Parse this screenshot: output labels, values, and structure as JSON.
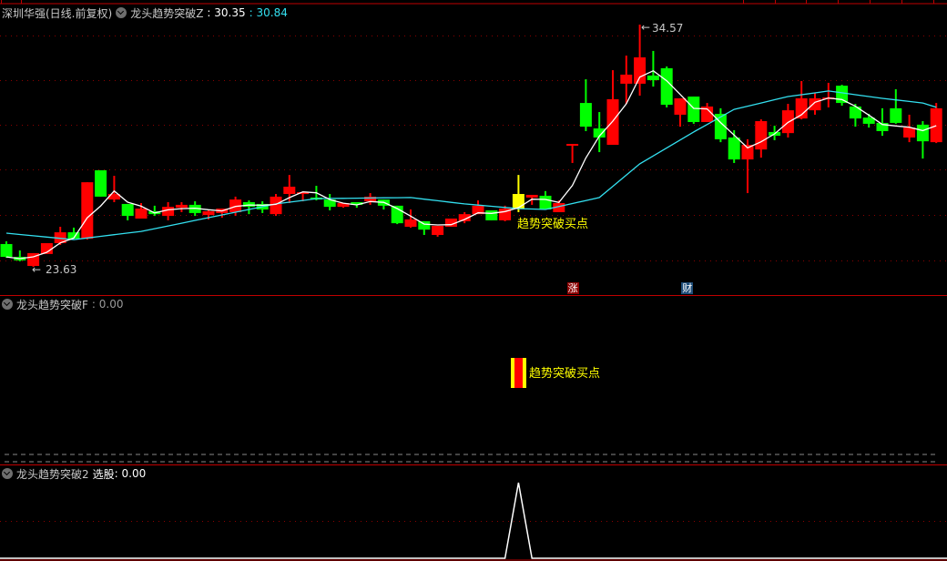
{
  "header": {
    "stock": "深圳华强(日线.前复权)",
    "indicator": "龙头趋势突破Z",
    "value_white": ": 30.35",
    "value_cyan": ": 30.84"
  },
  "panel2": {
    "title": "龙头趋势突破F",
    "value": ": 0.00",
    "signal_label": "趋势突破买点"
  },
  "panel3": {
    "title": "龙头趋势突破2",
    "label": "选股",
    "value": ": 0.00"
  },
  "main": {
    "signal_label": "趋势突破买点",
    "high_label": "34.57",
    "low_label": "23.63",
    "tag_zhang": "涨",
    "tag_cai": "财"
  },
  "colors": {
    "up": "#ff0000",
    "down": "#00ff00",
    "signal": "#ffff00",
    "ma_short": "#ffffff",
    "ma_long": "#33e0f0",
    "grid": "#8b0000"
  },
  "chart_data": {
    "type": "candlestick",
    "title": "深圳华强(日线.前复权)",
    "price_range": [
      23.63,
      34.57
    ],
    "ohlc": [
      [
        24.66,
        24.78,
        24.04,
        24.08
      ],
      [
        24.08,
        24.37,
        23.88,
        23.92
      ],
      [
        23.67,
        24.25,
        23.63,
        24.25
      ],
      [
        24.21,
        24.7,
        24.21,
        24.7
      ],
      [
        24.7,
        25.44,
        24.62,
        25.19
      ],
      [
        25.19,
        25.4,
        24.9,
        24.9
      ],
      [
        24.9,
        27.45,
        24.86,
        27.45
      ],
      [
        27.99,
        27.99,
        26.8,
        26.8
      ],
      [
        26.67,
        27.74,
        26.55,
        26.92
      ],
      [
        26.47,
        26.47,
        25.73,
        25.93
      ],
      [
        25.81,
        26.51,
        25.81,
        26.26
      ],
      [
        26.14,
        26.39,
        25.93,
        26.01
      ],
      [
        25.93,
        26.55,
        25.73,
        26.34
      ],
      [
        26.3,
        26.55,
        26.1,
        26.43
      ],
      [
        26.43,
        26.59,
        25.93,
        26.06
      ],
      [
        25.97,
        26.18,
        25.77,
        26.14
      ],
      [
        26.06,
        26.26,
        25.85,
        26.26
      ],
      [
        26.1,
        26.8,
        25.93,
        26.67
      ],
      [
        26.55,
        26.63,
        26.01,
        26.34
      ],
      [
        26.47,
        26.59,
        26.06,
        26.22
      ],
      [
        26.01,
        26.92,
        25.93,
        26.8
      ],
      [
        26.92,
        27.78,
        26.51,
        27.25
      ],
      [
        26.92,
        27.0,
        26.59,
        27.0
      ],
      [
        26.76,
        27.29,
        26.63,
        26.67
      ],
      [
        26.67,
        26.92,
        26.18,
        26.34
      ],
      [
        26.34,
        26.51,
        26.3,
        26.51
      ],
      [
        26.55,
        26.55,
        26.3,
        26.43
      ],
      [
        26.59,
        26.96,
        26.43,
        26.8
      ],
      [
        26.67,
        26.67,
        26.22,
        26.39
      ],
      [
        26.39,
        26.39,
        25.56,
        25.6
      ],
      [
        25.44,
        26.22,
        25.4,
        25.77
      ],
      [
        25.69,
        25.69,
        25.07,
        25.31
      ],
      [
        25.07,
        25.48,
        24.99,
        25.48
      ],
      [
        25.44,
        25.81,
        25.44,
        25.81
      ],
      [
        25.69,
        26.1,
        25.6,
        26.01
      ],
      [
        26.01,
        26.63,
        26.01,
        26.39
      ],
      [
        26.18,
        26.18,
        25.73,
        25.73
      ],
      [
        25.73,
        26.39,
        25.69,
        26.26
      ],
      [
        26.26,
        27.78,
        26.1,
        26.92
      ],
      [
        26.76,
        26.88,
        26.43,
        26.88
      ],
      [
        26.84,
        27.05,
        26.22,
        26.22
      ],
      [
        26.1,
        26.63,
        26.1,
        26.51
      ],
      [
        29.18,
        29.18,
        28.32,
        29.18
      ],
      [
        31.03,
        32.1,
        29.76,
        29.96
      ],
      [
        29.88,
        30.62,
        28.81,
        29.47
      ],
      [
        29.14,
        32.51,
        29.14,
        31.2
      ],
      [
        31.9,
        33.17,
        30.99,
        32.31
      ],
      [
        31.9,
        34.57,
        31.36,
        33.09
      ],
      [
        32.27,
        33.38,
        31.77,
        32.06
      ],
      [
        32.6,
        32.68,
        30.83,
        30.95
      ],
      [
        30.5,
        31.24,
        29.96,
        31.24
      ],
      [
        31.32,
        31.32,
        30.09,
        30.17
      ],
      [
        30.17,
        31.03,
        30.17,
        30.87
      ],
      [
        30.54,
        30.79,
        29.26,
        29.39
      ],
      [
        29.47,
        29.8,
        28.32,
        28.48
      ],
      [
        28.48,
        29.39,
        26.96,
        29.14
      ],
      [
        28.93,
        30.29,
        28.56,
        30.21
      ],
      [
        29.72,
        30.0,
        29.35,
        29.55
      ],
      [
        29.67,
        30.99,
        29.47,
        30.7
      ],
      [
        30.33,
        32.02,
        30.29,
        31.24
      ],
      [
        30.7,
        31.48,
        30.5,
        31.24
      ],
      [
        31.2,
        31.94,
        30.83,
        31.28
      ],
      [
        31.81,
        31.85,
        30.91,
        31.03
      ],
      [
        30.87,
        30.99,
        29.96,
        30.33
      ],
      [
        30.37,
        30.54,
        29.92,
        30.09
      ],
      [
        30.13,
        30.79,
        29.55,
        29.76
      ],
      [
        30.79,
        31.65,
        30.09,
        30.13
      ],
      [
        29.47,
        30.5,
        29.26,
        29.92
      ],
      [
        30.05,
        30.21,
        28.52,
        29.3
      ],
      [
        29.26,
        31.03,
        29.22,
        30.79
      ]
    ],
    "signal_index": 38,
    "ma_long_points": [
      [
        0,
        25.15
      ],
      [
        5,
        24.86
      ],
      [
        10,
        25.23
      ],
      [
        20,
        26.47
      ],
      [
        23,
        26.71
      ],
      [
        30,
        26.76
      ],
      [
        34,
        26.47
      ],
      [
        38,
        26.26
      ],
      [
        40,
        26.22
      ],
      [
        44,
        26.76
      ],
      [
        47,
        28.28
      ],
      [
        51,
        29.72
      ],
      [
        54,
        30.74
      ],
      [
        58,
        31.32
      ],
      [
        61,
        31.57
      ],
      [
        65,
        31.24
      ],
      [
        68,
        31.03
      ],
      [
        69,
        30.84
      ]
    ],
    "ma_short_period": 3,
    "tag_zhang_index": 42,
    "tag_cai_index": 49,
    "panel3_values": {
      "zero_except_index": 38,
      "peak_value": 1
    }
  }
}
